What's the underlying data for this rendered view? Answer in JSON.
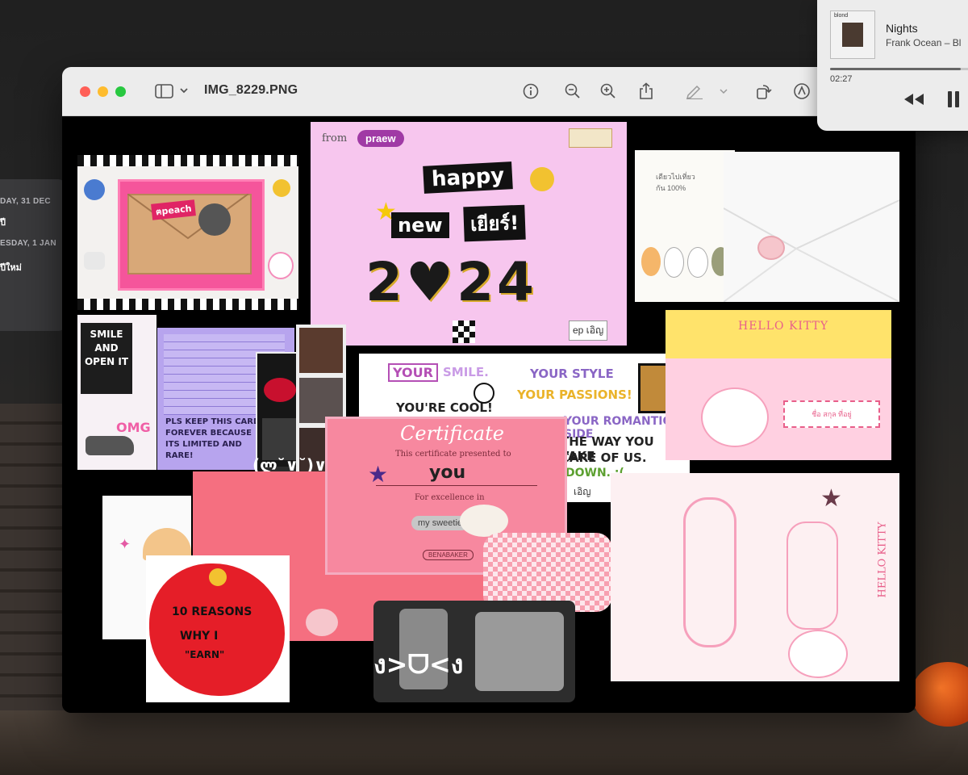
{
  "window": {
    "title": "IMG_8229.PNG",
    "toolbar": {
      "sidebar_icon": "sidebar-icon",
      "info_icon": "info-icon",
      "zoom_out_icon": "zoom-out-icon",
      "zoom_in_icon": "zoom-in-icon",
      "share_icon": "share-icon",
      "markup_icon": "pencil-icon",
      "rotate_icon": "rotate-icon",
      "annotate_icon": "markup-circle-icon"
    }
  },
  "calendar": {
    "rows": [
      {
        "date": "DAY, 31 DEC",
        "event": "ปี"
      },
      {
        "date": "ESDAY, 1 JAN",
        "event": "ปีใหม่"
      }
    ]
  },
  "now_playing": {
    "album_label": "blond",
    "title": "Nights",
    "artist": "Frank Ocean – Bl",
    "elapsed": "02:27",
    "progress": 0.9
  },
  "collage": {
    "card_main": {
      "from": "from",
      "sender": "praew",
      "line1": "happy",
      "line2": "new",
      "line3": "เยียร์!",
      "year": "2♥24",
      "signature": "ep เอิญ"
    },
    "envelope_top_left": {
      "tag": "ฅpeach"
    },
    "open_card": {
      "line1": "SMILE",
      "line2": "AND",
      "line3": "OPEN IT",
      "omg": "OMG"
    },
    "letter_note": {
      "text": "PLS KEEP THIS CARD FOREVER BECAUSE ITS LIMITED AND RARE!"
    },
    "compliments": {
      "items": [
        "YOUR",
        "SMILE.",
        "YOUR STYLE",
        "YOUR PASSIONS!",
        "YOU'RE COOL!",
        "YOUR ROMANTIC SIDE",
        "THE WAY YOU TAKE",
        "CARE OF US.",
        "DOWN. :("
      ],
      "signature": "เอิญ"
    },
    "certificate": {
      "title": "Certificate",
      "presented": "This certificate presented to",
      "name": "you",
      "excellence": "For excellence in",
      "field": "my sweetie",
      "brand": "BENABAKER"
    },
    "photostrip_caption": "(ლ˘∨˘)∨",
    "reasons": {
      "line1": "10 REASONS",
      "line2": "WHY I",
      "line3": "\"EARN\""
    },
    "kaomoji": "ง>ᗜ<ง",
    "hello_kitty_envelope": {
      "brand": "HELLO KITTY",
      "address": "ชื่อ สกุล ที่อยู่"
    },
    "hello_kitty_letter": {
      "brand": "HELLO KITTY"
    },
    "small_card": {
      "text": "เดียวไปเที่ยวกัน 100%"
    }
  },
  "colors": {
    "card_pink": "#f7c6ee",
    "cert_pink": "#f7889f",
    "red": "#e3202a",
    "yellow_env": "#ffe36b"
  }
}
